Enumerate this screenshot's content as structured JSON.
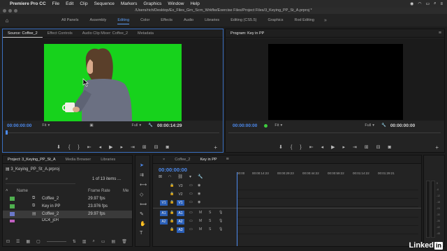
{
  "menubar": {
    "app": "Premiere Pro CC",
    "items": [
      "File",
      "Edit",
      "Clip",
      "Sequence",
      "Markers",
      "Graphics",
      "Window",
      "Help"
    ]
  },
  "titlebar": {
    "path": "/Users/rich/Desktop/Ex_Files_Grn_Scrn_Wrkflw/Exercise Files/Project Files/3_Keying_PP_St_A.prproj *"
  },
  "workspaces": {
    "items": [
      "All Panels",
      "Assembly",
      "Editing",
      "Color",
      "Effects",
      "Audio",
      "Libraries",
      "Editing (CS5.5)",
      "Graphics",
      "Rod Editing"
    ],
    "active": "Editing"
  },
  "source": {
    "tabs": [
      "Source: Coffee_2",
      "Effect Controls",
      "Audio Clip Mixer: Coffee_2",
      "Metadata"
    ],
    "timecode_in": "00:00:00:00",
    "fit": "Fit",
    "quality": "Full",
    "timecode_out": "00:00:14:29"
  },
  "program": {
    "tabs": [
      "Program: Key in PP"
    ],
    "timecode_in": "00:00:00:00",
    "fit": "Fit",
    "quality": "Full",
    "timecode_out": "00:00:00:00"
  },
  "project": {
    "tabs": [
      "Project: 3_Keying_PP_St_A",
      "Media Browser",
      "Libraries"
    ],
    "file": "3_Keying_PP_St_A.prproj",
    "count": "1 of 13 items ...",
    "columns": [
      "Name",
      "Frame Rate",
      "Me"
    ],
    "rows": [
      {
        "name": "Coffee_2",
        "rate": "29.97 fps",
        "color": "#4fb04f",
        "selected": false
      },
      {
        "name": "Key in PP",
        "rate": "23.976 fps",
        "color": "#4fb04f",
        "selected": false
      },
      {
        "name": "Coffee_2",
        "rate": "29.97 fps",
        "color": "#6b78c8",
        "selected": true
      },
      {
        "name": "DC4_jcH",
        "rate": "",
        "color": "#c05fc0",
        "selected": false
      }
    ]
  },
  "timeline": {
    "tabs": [
      "Coffee_2",
      "Key in PP"
    ],
    "timecode": "00:00:00:00",
    "ruler": [
      "00:00",
      "00:00:14:23",
      "00:00:29:23",
      "00:00:44:22",
      "00:00:59:22",
      "00:01:14:22",
      "00:01:29:21"
    ],
    "video_tracks": [
      "V3",
      "V2",
      "V1"
    ],
    "audio_tracks": [
      "A1",
      "A2",
      "A3"
    ],
    "source_video": "V1",
    "source_audio": [
      "A1",
      "A2"
    ]
  },
  "meters": {
    "scale": [
      "0",
      "-6",
      "-12",
      "-18",
      "-24",
      "-30",
      "-36",
      "-42",
      "-48",
      "-54"
    ]
  },
  "watermark": {
    "brand": "Linked",
    "suffix": "in"
  },
  "colors": {
    "accent": "#4d8bf0",
    "green_screen": "#17d21c"
  }
}
